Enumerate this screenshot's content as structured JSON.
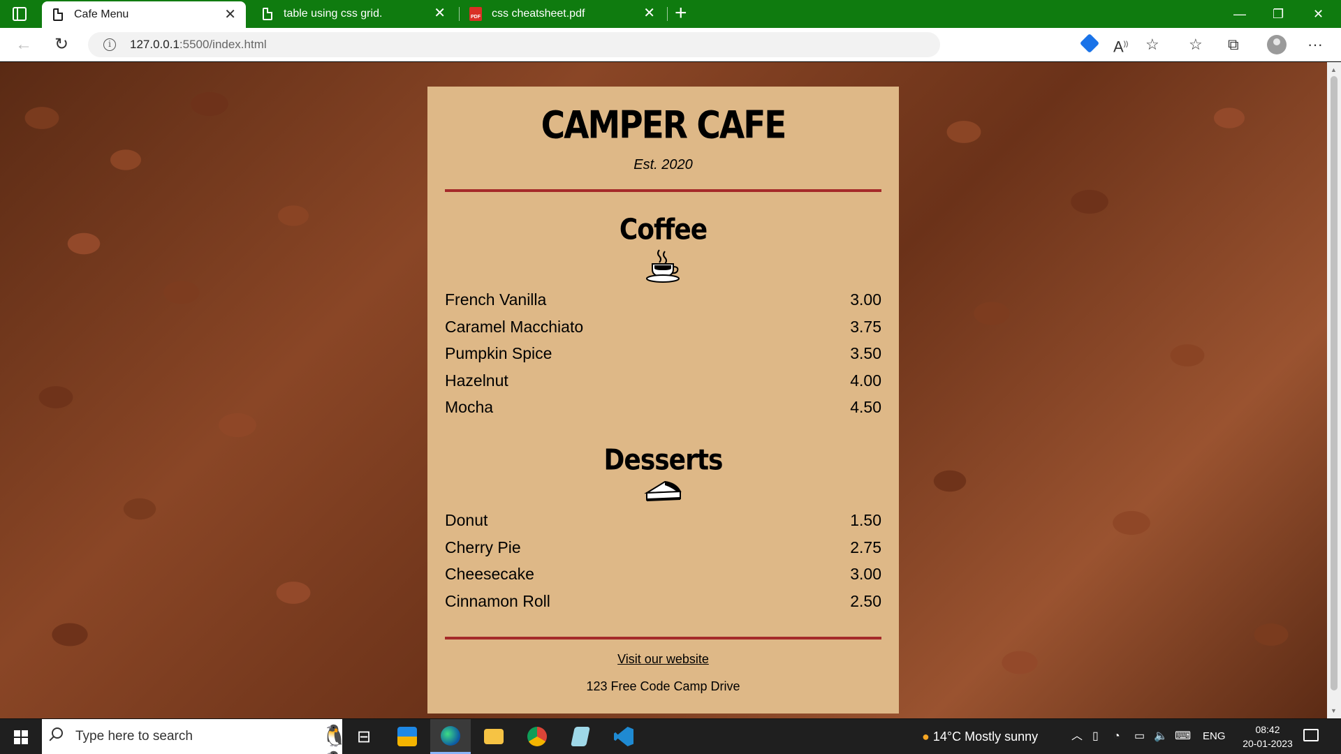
{
  "browser": {
    "tabs": [
      {
        "title": "Cafe Menu",
        "active": true,
        "icon": "page-icon"
      },
      {
        "title": "table using css grid.",
        "active": false,
        "icon": "page-icon"
      },
      {
        "title": "css cheatsheet.pdf",
        "active": false,
        "icon": "pdf-icon"
      }
    ],
    "close_glyph": "✕",
    "new_tab_glyph": "+",
    "url_host": "127.0.0.1",
    "url_path": ":5500/index.html"
  },
  "menu": {
    "title": "CAMPER CAFE",
    "established": "Est. 2020",
    "sections": [
      {
        "name": "Coffee",
        "icon": "coffee-cup-icon",
        "items": [
          {
            "name": "French Vanilla",
            "price": "3.00"
          },
          {
            "name": "Caramel Macchiato",
            "price": "3.75"
          },
          {
            "name": "Pumpkin Spice",
            "price": "3.50"
          },
          {
            "name": "Hazelnut",
            "price": "4.00"
          },
          {
            "name": "Mocha",
            "price": "4.50"
          }
        ]
      },
      {
        "name": "Desserts",
        "icon": "pie-slice-icon",
        "items": [
          {
            "name": "Donut",
            "price": "1.50"
          },
          {
            "name": "Cherry Pie",
            "price": "2.75"
          },
          {
            "name": "Cheesecake",
            "price": "3.00"
          },
          {
            "name": "Cinnamon Roll",
            "price": "2.50"
          }
        ]
      }
    ],
    "footer_link": "Visit our website",
    "address": "123 Free Code Camp Drive",
    "divider_color": "#a52a2a",
    "card_color": "#deb887"
  },
  "taskbar": {
    "search_placeholder": "Type here to search",
    "weather": "14°C  Mostly sunny",
    "language": "ENG",
    "time": "08:42",
    "date": "20-01-2023"
  },
  "colors": {
    "tabbar": "#0f7b0f"
  }
}
